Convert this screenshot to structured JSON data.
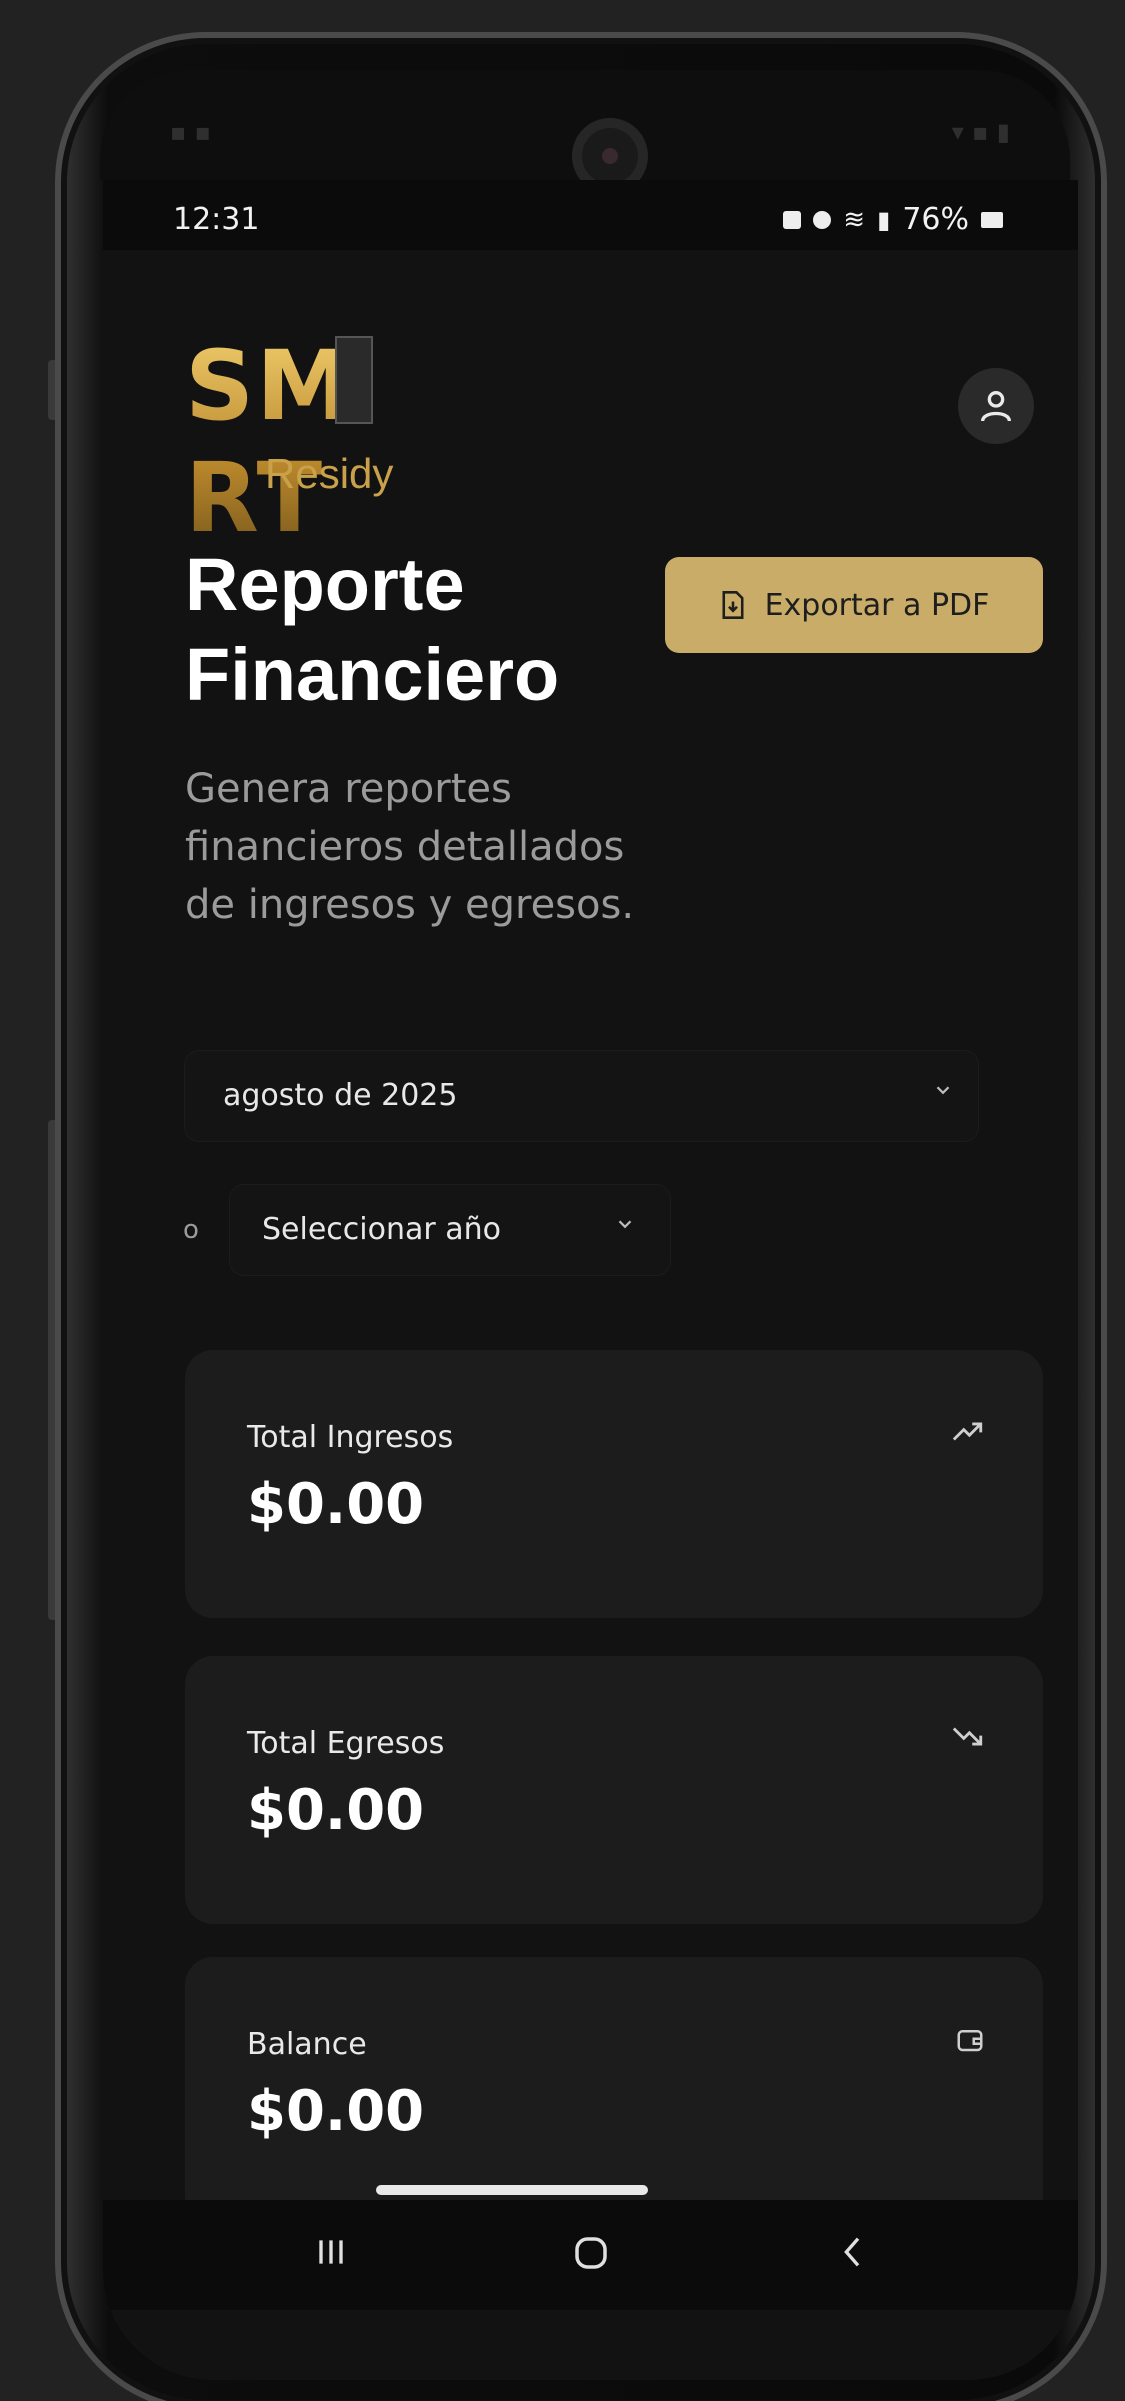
{
  "status_bar": {
    "time": "12:31",
    "battery": "76%"
  },
  "logo": {
    "main_text": "SM RT",
    "sub_text": "Residy"
  },
  "page": {
    "title": "Reporte Financiero",
    "subtitle": "Genera reportes financieros detallados de ingresos y egresos."
  },
  "actions": {
    "export_label": "Exportar a PDF"
  },
  "filters": {
    "month_value": "agosto de 2025",
    "separator": "o",
    "year_placeholder": "Seleccionar año"
  },
  "cards": [
    {
      "label": "Total Ingresos",
      "value": "$0.00",
      "icon": "trending-up-icon"
    },
    {
      "label": "Total Egresos",
      "value": "$0.00",
      "icon": "trending-down-icon"
    },
    {
      "label": "Balance",
      "value": "$0.00",
      "icon": "wallet-icon"
    }
  ],
  "colors": {
    "accent_gold": "#c9ac67",
    "background": "#121212",
    "card_background": "#1c1c1c"
  }
}
